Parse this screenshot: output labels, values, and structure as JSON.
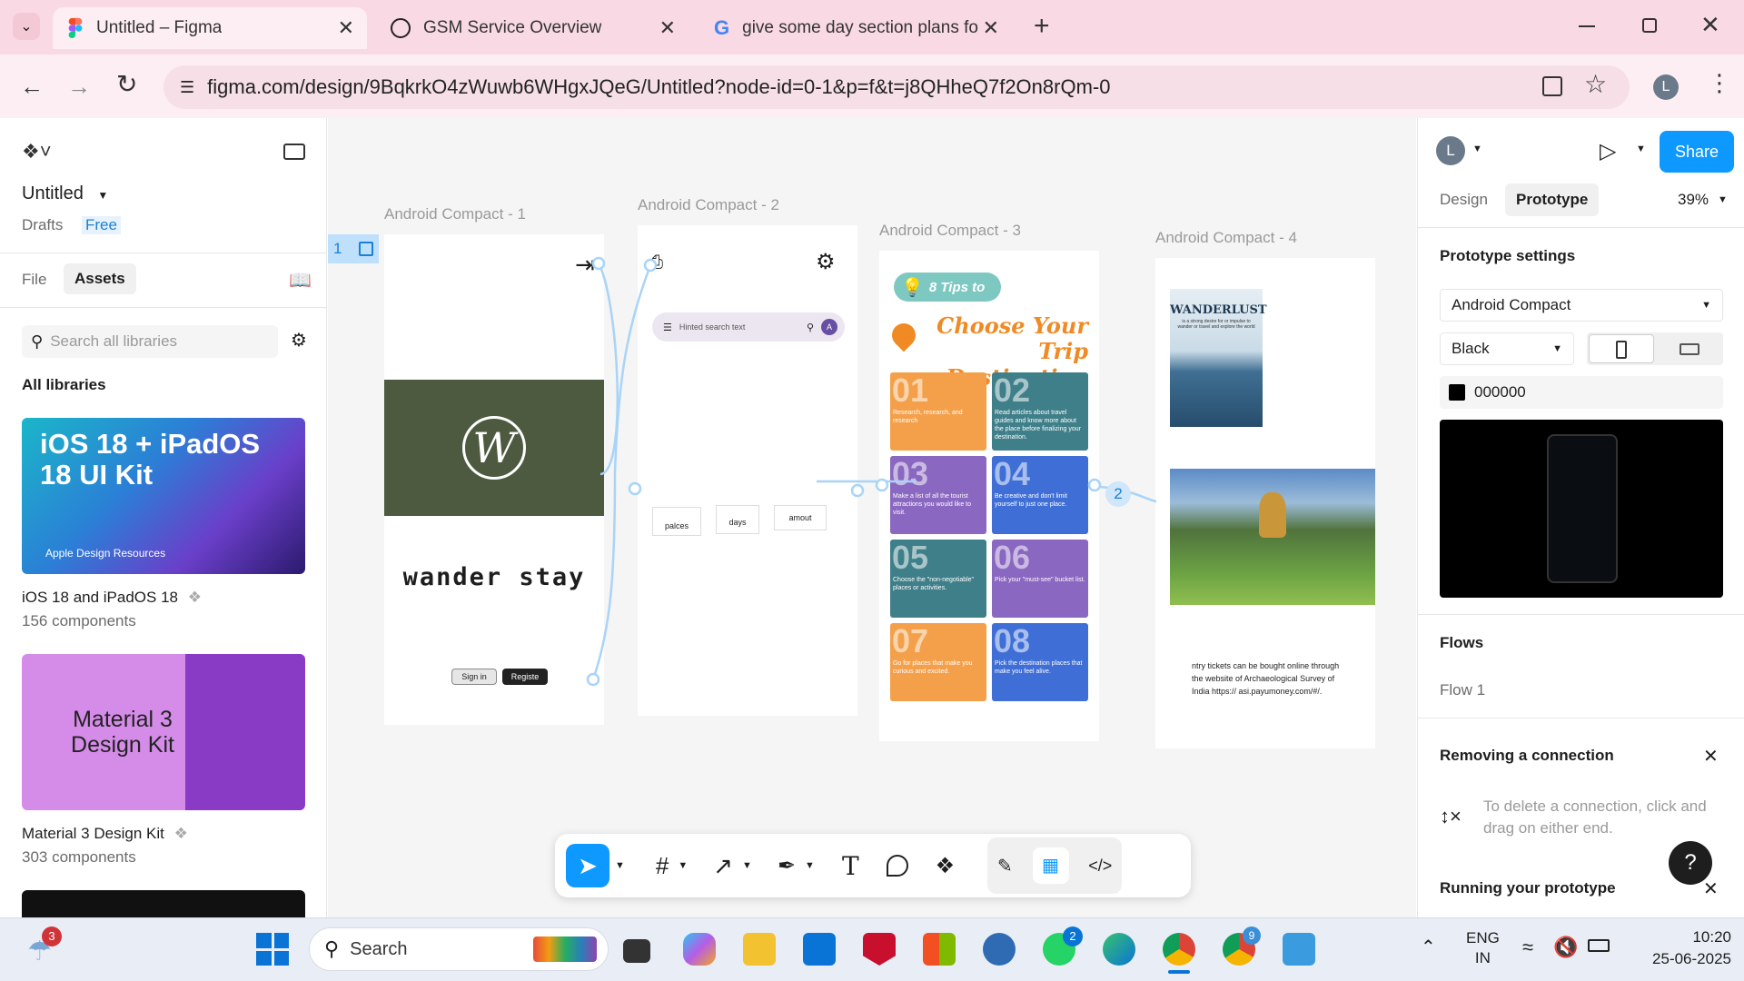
{
  "browser": {
    "tabs": [
      {
        "title": "Untitled – Figma",
        "active": true
      },
      {
        "title": "GSM Service Overview",
        "active": false
      },
      {
        "title": "give some day section plans for",
        "active": false
      }
    ],
    "url": "figma.com/design/9BqkrkO4zWuwb6WHgxJQeG/Untitled?node-id=0-1&p=f&t=j8QHheQ7f2On8rQm-0",
    "profile_initial": "L"
  },
  "left_panel": {
    "file_name": "Untitled",
    "drafts": "Drafts",
    "plan": "Free",
    "tabs": [
      "File",
      "Assets"
    ],
    "search_placeholder": "Search all libraries",
    "section_title": "All libraries",
    "libraries": [
      {
        "cover_title": "iOS 18 + iPadOS 18 UI Kit",
        "cover_caption": "Apple Design Resources",
        "name": "iOS 18 and iPadOS 18",
        "count": "156 components"
      },
      {
        "cover_title": "Material 3 Design Kit",
        "name": "Material 3 Design Kit",
        "count": "303 components"
      }
    ]
  },
  "canvas": {
    "flow_tag": "1",
    "frames": [
      {
        "label": "Android Compact - 1",
        "brand": "wander stay",
        "buttons": [
          "Sign in",
          "Registe"
        ]
      },
      {
        "label": "Android Compact - 2",
        "search_hint": "Hinted search text",
        "avatar": "A",
        "chips": [
          "palces",
          "days",
          "amout"
        ]
      },
      {
        "label": "Android Compact - 3",
        "badge": "8 Tips to",
        "headline1": "Choose Your",
        "headline2": "Trip Destination",
        "tips": [
          {
            "n": "01",
            "text": "Research, research, and research",
            "color": "#f4a04a"
          },
          {
            "n": "02",
            "text": "Read articles about travel guides and know more about the place before finalizing your destination.",
            "color": "#3f7f89"
          },
          {
            "n": "03",
            "text": "Make a list of all the tourist attractions you would like to visit.",
            "color": "#8a67c0"
          },
          {
            "n": "04",
            "text": "Be creative and don't limit yourself to just one place.",
            "color": "#3f6fd6"
          },
          {
            "n": "05",
            "text": "Choose the \"non-negotiable\" places or activities.",
            "color": "#3f7f89"
          },
          {
            "n": "06",
            "text": "Pick your \"must-see\" bucket list.",
            "color": "#8a67c0"
          },
          {
            "n": "07",
            "text": "Go for places that make you curious and excited.",
            "color": "#f4a04a"
          },
          {
            "n": "08",
            "text": "Pick the destination places that make you feel alive.",
            "color": "#3f6fd6"
          }
        ]
      },
      {
        "label": "Android Compact - 4",
        "poster_title": "WANDERLUST",
        "poster_caption": "is a strong desire for or impulse to wander or travel and explore the world",
        "text": "ntry tickets can be bought online through the website of Archaeological Survey of India https:// asi.payumoney.com/#/."
      }
    ],
    "connection_badge": "2"
  },
  "right_panel": {
    "avatar": "L",
    "share": "Share",
    "tabs": [
      "Design",
      "Prototype"
    ],
    "zoom": "39%",
    "prototype_settings": "Prototype settings",
    "device": "Android Compact",
    "color_model": "Black",
    "hex": "000000",
    "flows_title": "Flows",
    "flow_item": "Flow 1",
    "hint_title": "Removing a connection",
    "hint_text": "To delete a connection, click and drag on either end.",
    "running_title": "Running your prototype",
    "help": "?"
  },
  "taskbar": {
    "search": "Search",
    "lang1": "ENG",
    "lang2": "IN",
    "time": "10:20",
    "date": "25-06-2025",
    "badge_weather": "3",
    "badge_whatsapp": "2",
    "badge_chrome2": "9"
  }
}
